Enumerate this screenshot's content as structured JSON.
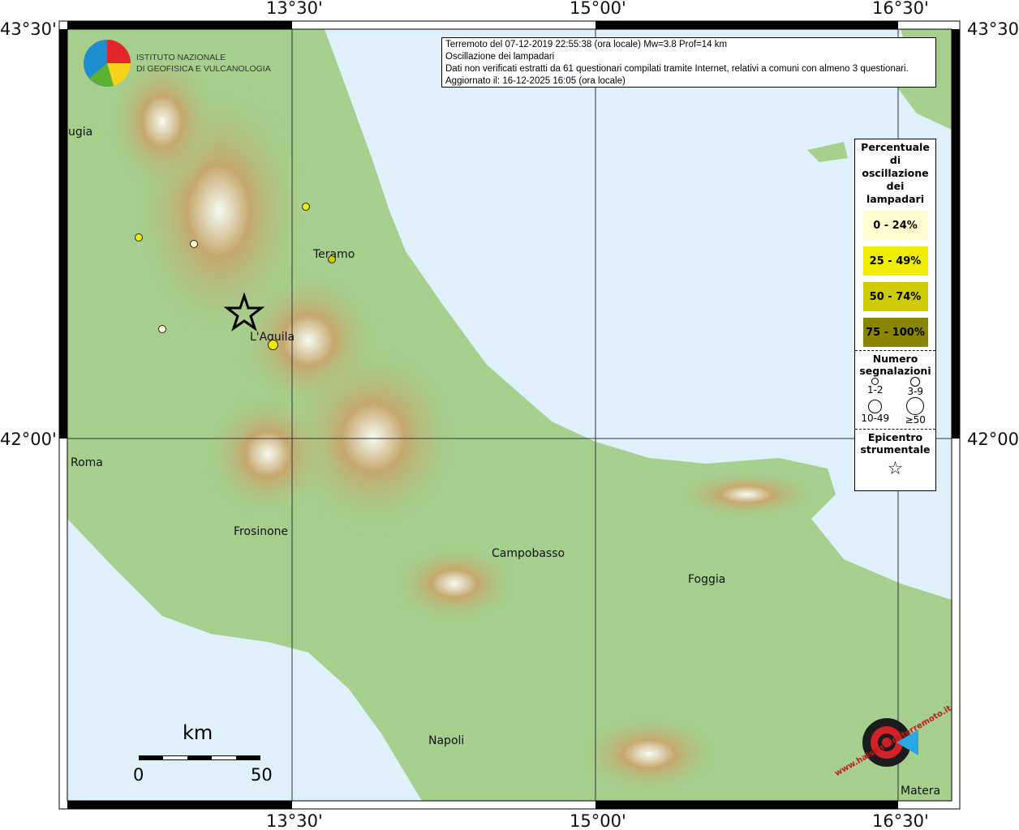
{
  "axes": {
    "top_ticks": [
      "13°30'",
      "15°00'",
      "16°30'"
    ],
    "bottom_ticks": [
      "13°30'",
      "15°00'",
      "16°30'"
    ],
    "left_ticks": [
      "43°30'",
      "42°00'"
    ],
    "right_ticks": [
      "43°30'",
      "42°00'"
    ]
  },
  "info": {
    "lines": [
      "Terremoto del 07-12-2019 22:55:38 (ora locale) Mw=3.8 Prof=14 km",
      "Oscillazione dei lampadari",
      "Dati non verificati estratti da 61 questionari compilati tramite Internet, relativi a comuni con almeno 3 questionari.",
      "Aggiornato il: 16-12-2025 16:05 (ora locale)"
    ]
  },
  "logo_ingv": {
    "line1": "ISTITUTO NAZIONALE",
    "line2": "DI GEOFISICA E VULCANOLOGIA"
  },
  "logo_hsit": {
    "text": "www.haisentitoilterremoto.it"
  },
  "legend": {
    "title": [
      "Percentuale",
      "di",
      "oscillazione",
      "dei",
      "lampadari"
    ],
    "classes": [
      {
        "label": "0 - 24%",
        "color": "#fffcd0"
      },
      {
        "label": "25 - 49%",
        "color": "#f0ee00"
      },
      {
        "label": "50 - 74%",
        "color": "#d0cb00"
      },
      {
        "label": "75 - 100%",
        "color": "#8a8500"
      }
    ],
    "count_title": [
      "Numero",
      "segnalazioni"
    ],
    "counts": [
      "1-2",
      "3-9",
      "10-49",
      "≥50"
    ],
    "epi_title": [
      "Epicentro",
      "strumentale"
    ]
  },
  "cities": [
    "ugia",
    "Teramo",
    "L'Aquila",
    "Roma",
    "Frosinone",
    "Campobasso",
    "Foggia",
    "Napoli",
    "Matera"
  ],
  "scale": {
    "unit": "km",
    "min": "0",
    "max": "50"
  },
  "colors": {
    "sea": "#dff0fb",
    "land": "#a6cf8d",
    "highland": "#c6a96a",
    "grid": "#333333"
  }
}
